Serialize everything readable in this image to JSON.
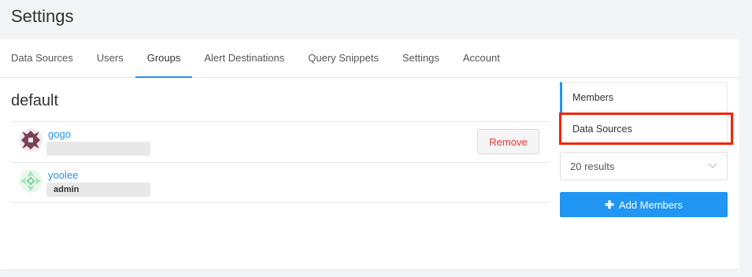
{
  "page": {
    "title": "Settings"
  },
  "tabs": [
    {
      "label": "Data Sources"
    },
    {
      "label": "Users"
    },
    {
      "label": "Groups",
      "active": true
    },
    {
      "label": "Alert Destinations"
    },
    {
      "label": "Query Snippets"
    },
    {
      "label": "Settings"
    },
    {
      "label": "Account"
    }
  ],
  "group": {
    "name": "default"
  },
  "members": [
    {
      "name": "gogo",
      "badge": "",
      "action_label": "Remove",
      "avatar_icon": "identicon-maroon-icon"
    },
    {
      "name": "yoolee",
      "badge": "admin",
      "avatar_icon": "identicon-green-icon"
    }
  ],
  "side_menu": {
    "items": [
      {
        "label": "Members",
        "active": true
      },
      {
        "label": "Data Sources",
        "highlighted": true
      }
    ]
  },
  "results": {
    "selected": "20 results"
  },
  "add_members": {
    "label": "Add Members",
    "icon": "plus-icon"
  },
  "colors": {
    "accent": "#2196f3",
    "remove_text": "#e6373a",
    "highlight_box": "#f5230a"
  }
}
